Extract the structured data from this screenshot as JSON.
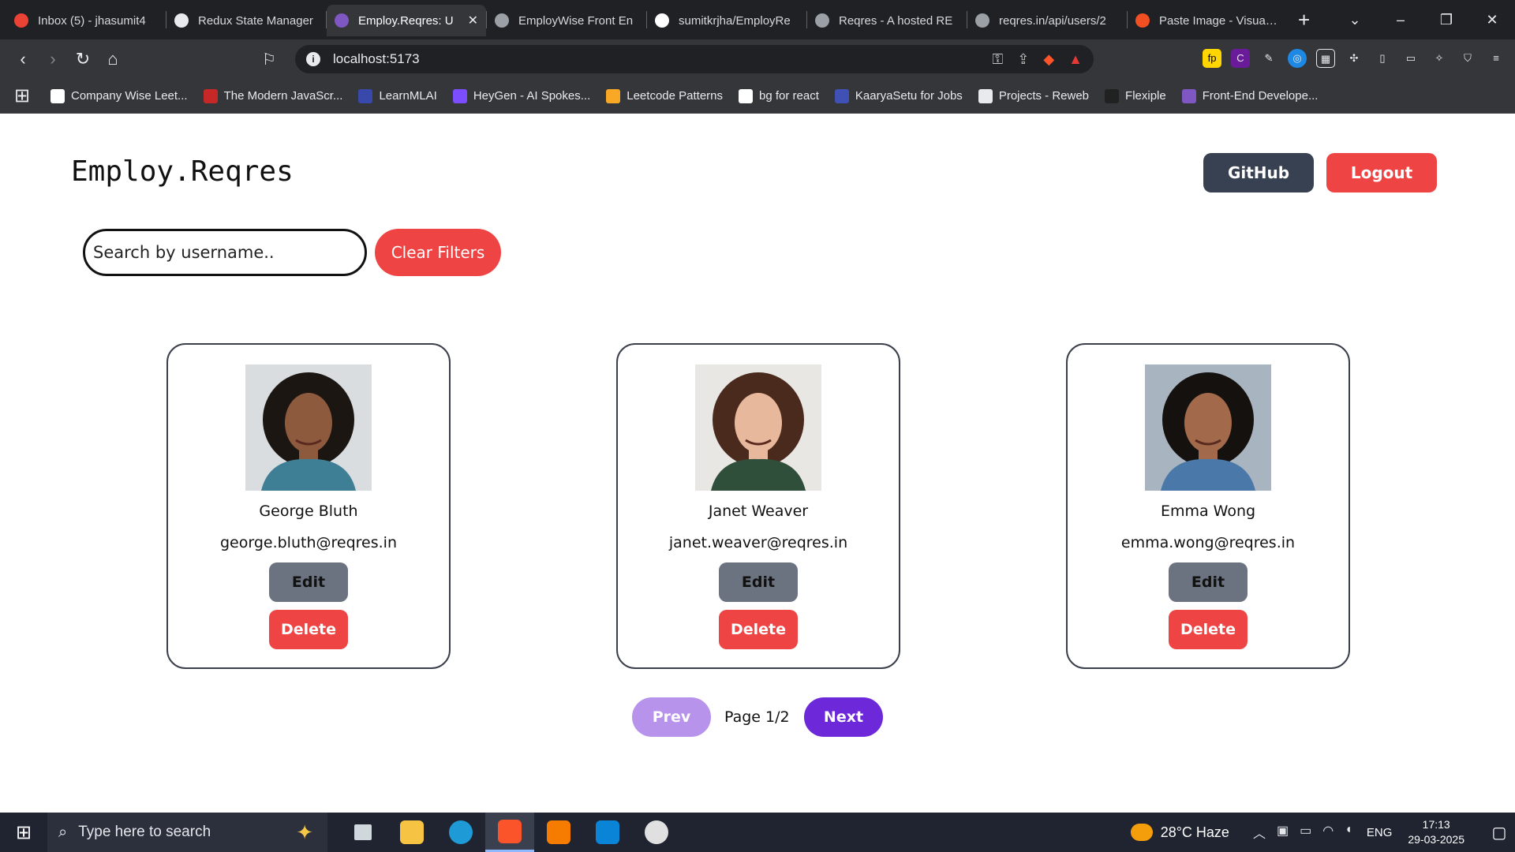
{
  "browser": {
    "tabs": [
      {
        "title": "Inbox (5) - jhasumit4",
        "favicon_color": "#ea4335",
        "active": false
      },
      {
        "title": "Redux State Manager",
        "favicon_color": "#e8eaed",
        "active": false
      },
      {
        "title": "Employ.Reqres: U",
        "favicon_color": "#7e57c2",
        "active": true
      },
      {
        "title": "EmployWise Front En",
        "favicon_color": "#9aa0a6",
        "active": false
      },
      {
        "title": "sumitkrjha/EmployRe",
        "favicon_color": "#ffffff",
        "active": false
      },
      {
        "title": "Reqres - A hosted RE",
        "favicon_color": "#9aa0a6",
        "active": false
      },
      {
        "title": "reqres.in/api/users/2",
        "favicon_color": "#9aa0a6",
        "active": false
      },
      {
        "title": "Paste Image - Visual S",
        "favicon_color": "#f25022",
        "active": false
      }
    ],
    "close_glyph": "✕",
    "new_tab_glyph": "+",
    "address": "localhost:5173",
    "info_glyph": "i",
    "bookmarks": [
      {
        "label": "Company Wise Leet...",
        "icon_color": "#ffffff"
      },
      {
        "label": "The Modern JavaScr...",
        "icon_color": "#c62828"
      },
      {
        "label": "LearnMLAI",
        "icon_color": "#3949ab"
      },
      {
        "label": "HeyGen - AI Spokes...",
        "icon_color": "#7c4dff"
      },
      {
        "label": "Leetcode Patterns",
        "icon_color": "#f9a825"
      },
      {
        "label": "bg for react",
        "icon_color": "#ffffff"
      },
      {
        "label": "KaaryaSetu for Jobs",
        "icon_color": "#3f51b5"
      },
      {
        "label": "Projects - Reweb",
        "icon_color": "#e8eaed"
      },
      {
        "label": "Flexiple",
        "icon_color": "#212121"
      },
      {
        "label": "Front-End Develope...",
        "icon_color": "#7e57c2"
      }
    ]
  },
  "app": {
    "brand": "Employ.Reqres",
    "github_label": "GitHub",
    "logout_label": "Logout",
    "search_placeholder": "Search by username..",
    "clear_label": "Clear Filters",
    "edit_label": "Edit",
    "delete_label": "Delete",
    "users": [
      {
        "name": "George Bluth",
        "email": "george.bluth@reqres.in",
        "photo_bg": "#d9dde0",
        "hair": "#1c1612",
        "skin": "#8d5a3e",
        "shirt": "#3f7f96"
      },
      {
        "name": "Janet Weaver",
        "email": "janet.weaver@reqres.in",
        "photo_bg": "#e9e7e3",
        "hair": "#4a2a1c",
        "skin": "#e8b89c",
        "shirt": "#2f4f3a"
      },
      {
        "name": "Emma Wong",
        "email": "emma.wong@reqres.in",
        "photo_bg": "#a8b4bf",
        "hair": "#15110f",
        "skin": "#a26a4a",
        "shirt": "#4a78a8"
      }
    ],
    "pagination": {
      "prev_label": "Prev",
      "next_label": "Next",
      "page_text": "Page 1/2"
    },
    "colors": {
      "danger": "#ef4444",
      "dark": "#374151",
      "edit": "#6b7280",
      "accent": "#6d28d9",
      "accent_disabled": "#b793ec"
    }
  },
  "taskbar": {
    "search_placeholder": "Type here to search",
    "weather": "28°C  Haze",
    "lang": "ENG",
    "time": "17:13",
    "date": "29-03-2025",
    "apps": [
      "task-view",
      "file-explorer",
      "edge",
      "brave",
      "vlc",
      "vscode",
      "clock"
    ]
  }
}
